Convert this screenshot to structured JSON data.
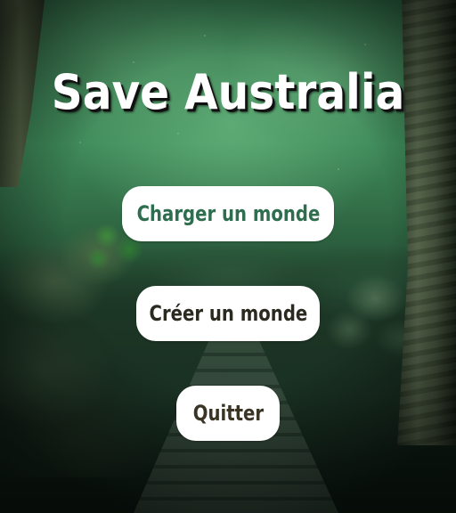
{
  "title": "Save Australia",
  "menu": {
    "load_label": "Charger un monde",
    "create_label": "Créer un monde",
    "quit_label": "Quitter"
  },
  "colors": {
    "button_background": "#ffffff",
    "load_text": "#2e6e4f",
    "create_text": "#2b2a20",
    "quit_text": "#3a3424",
    "title_text": "#ffffff"
  }
}
